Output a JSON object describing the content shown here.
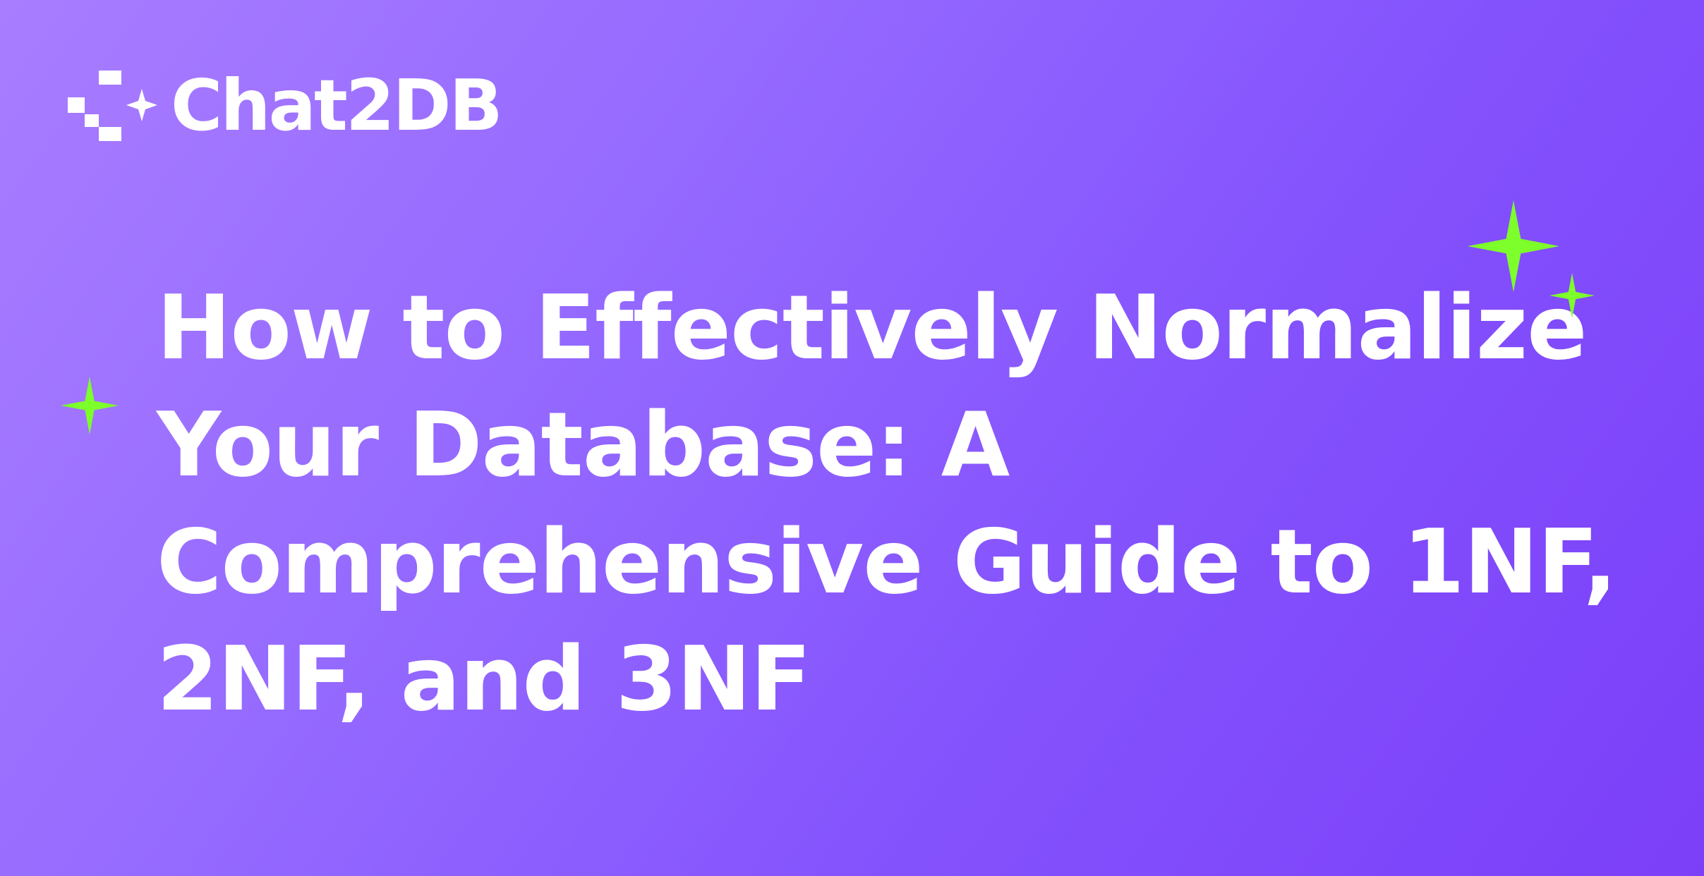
{
  "brand": {
    "name": "Chat2DB",
    "logo_icon": "chat2db-logo-icon"
  },
  "headline": {
    "lines": [
      "How to Effectively Normalize",
      "Your Database: A",
      "Comprehensive Guide to 1NF,",
      "2NF, and 3NF"
    ]
  },
  "decorations": {
    "sparkle_icon": "sparkle-icon",
    "sparkle_color": "#7dff2b"
  },
  "colors": {
    "background_start": "#a97dff",
    "background_end": "#7b3ff8",
    "text": "#ffffff"
  }
}
